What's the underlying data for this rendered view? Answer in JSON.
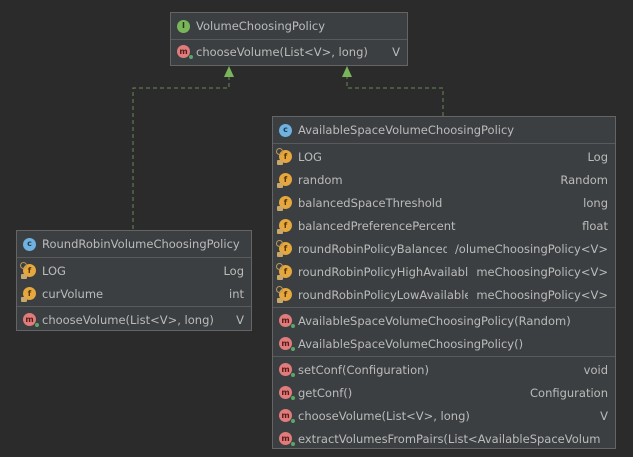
{
  "interface_box": {
    "name": "VolumeChoosingPolicy",
    "icon": "interface-icon",
    "methods": [
      {
        "name": "chooseVolume(List<V>, long)",
        "type": "V"
      }
    ]
  },
  "roundrobin_box": {
    "name": "RoundRobinVolumeChoosingPolicy",
    "icon": "class-icon",
    "fields": [
      {
        "name": "LOG",
        "type": "Log"
      },
      {
        "name": "curVolume",
        "type": "int"
      }
    ],
    "methods": [
      {
        "name": "chooseVolume(List<V>, long)",
        "type": "V"
      }
    ]
  },
  "available_box": {
    "name": "AvailableSpaceVolumeChoosingPolicy",
    "icon": "class-icon",
    "fields": [
      {
        "name": "LOG",
        "type": "Log"
      },
      {
        "name": "random",
        "type": "Random"
      },
      {
        "name": "balancedSpaceThreshold",
        "type": "long"
      },
      {
        "name": "balancedPreferencePercent",
        "type": "float"
      },
      {
        "name": "roundRobinPolicyBalanced",
        "type": "/olumeChoosingPolicy<V>"
      },
      {
        "name": "roundRobinPolicyHighAvailable",
        "type": "meChoosingPolicy<V>"
      },
      {
        "name": "roundRobinPolicyLowAvailable",
        "type": "meChoosingPolicy<V>"
      }
    ],
    "constructors": [
      {
        "name": "AvailableSpaceVolumeChoosingPolicy(Random)",
        "type": ""
      },
      {
        "name": "AvailableSpaceVolumeChoosingPolicy()",
        "type": ""
      }
    ],
    "methods": [
      {
        "name": "setConf(Configuration)",
        "type": "void"
      },
      {
        "name": "getConf()",
        "type": "Configuration"
      },
      {
        "name": "chooseVolume(List<V>, long)",
        "type": "V"
      },
      {
        "name": "extractVolumesFromPairs(List<AvailableSpaceVolumeP",
        "type": ""
      }
    ]
  },
  "colors": {
    "background": "#2b2b2b",
    "box_fill": "#3c3f41",
    "connector": "#6a8759",
    "arrowhead": "#79b65a"
  }
}
